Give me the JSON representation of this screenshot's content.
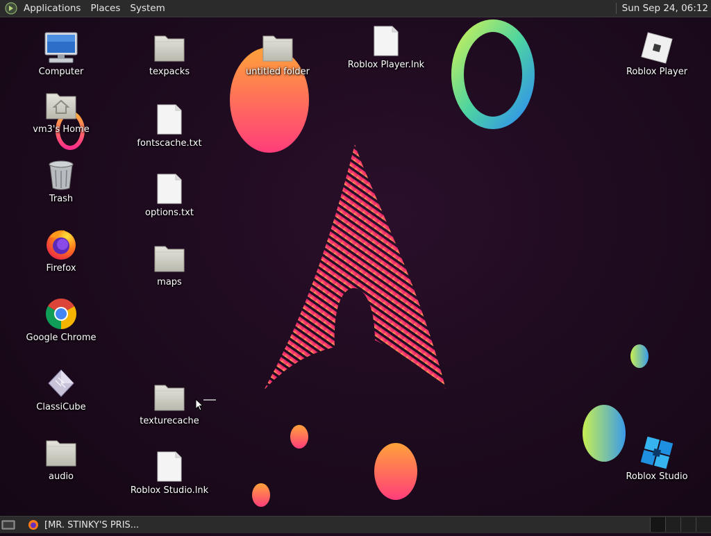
{
  "top_panel": {
    "menus": [
      "Applications",
      "Places",
      "System"
    ],
    "clock": "Sun Sep 24, 06:12"
  },
  "bottom_panel": {
    "task_title": "[MR. STINKY'S PRIS..."
  },
  "desktop_icons": {
    "computer": "Computer",
    "home": "vm3's Home",
    "trash": "Trash",
    "firefox": "Firefox",
    "chrome": "Google Chrome",
    "classicube": "ClassiCube",
    "audio": "audio",
    "texpacks": "texpacks",
    "fontscache": "fontscache.txt",
    "options": "options.txt",
    "maps": "maps",
    "texturecache": "texturecache",
    "roblox_studio_lnk": "Roblox Studio.lnk",
    "untitled_folder": "untitled folder",
    "roblox_player_lnk": "Roblox Player.lnk",
    "roblox_player": "Roblox Player",
    "roblox_studio": "Roblox Studio"
  },
  "icon_types": {
    "computer": "monitor-icon",
    "home": "home-folder-icon",
    "trash": "trash-icon",
    "firefox": "firefox-icon",
    "chrome": "chrome-icon",
    "classicube": "classicube-icon",
    "folder": "folder-icon",
    "file": "text-file-icon",
    "roblox_player": "roblox-player-icon",
    "roblox_studio": "roblox-studio-icon"
  },
  "colors": {
    "panel_bg": "#2b2b2b",
    "desktop_bg": "#1e0b1f",
    "accent_pink": "#e8256c",
    "accent_orange": "#ff9a3c",
    "accent_blue": "#3b8fe8"
  }
}
